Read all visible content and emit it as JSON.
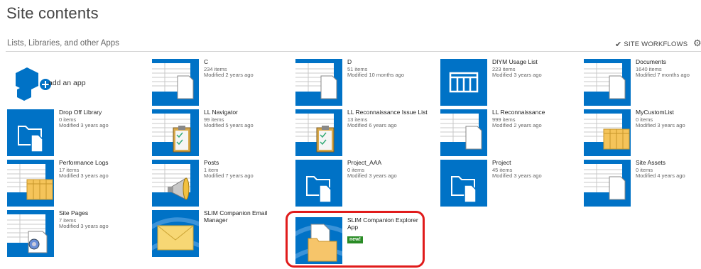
{
  "page": {
    "title": "Site contents",
    "subtitle": "Lists, Libraries, and other Apps",
    "workflows_label": "SITE WORKFLOWS"
  },
  "add_app": {
    "label": "add an app"
  },
  "tiles": [
    {
      "name": "C",
      "count": "234 items",
      "modified": "Modified 2 years ago",
      "icon": "list-icon"
    },
    {
      "name": "D",
      "count": "51 items",
      "modified": "Modified 10 months ago",
      "icon": "list-icon"
    },
    {
      "name": "DIYM Usage List",
      "count": "223 items",
      "modified": "Modified 3 years ago",
      "icon": "table-icon"
    },
    {
      "name": "Documents",
      "count": "1640 items",
      "modified": "Modified 7 months ago",
      "icon": "list-icon"
    },
    {
      "name": "Drop Off Library",
      "count": "0 items",
      "modified": "Modified 3 years ago",
      "icon": "folder-icon"
    },
    {
      "name": "LL Navigator",
      "count": "99 items",
      "modified": "Modified 5 years ago",
      "icon": "clipboard-icon"
    },
    {
      "name": "LL Reconnaissance Issue List",
      "count": "13 items",
      "modified": "Modified 6 years ago",
      "icon": "clipboard-icon"
    },
    {
      "name": "LL Reconnaissance",
      "count": "999 items",
      "modified": "Modified 2 years ago",
      "icon": "list-icon"
    },
    {
      "name": "MyCustomList",
      "count": "0 items",
      "modified": "Modified 3 years ago",
      "icon": "custom-list-icon"
    },
    {
      "name": "Performance Logs",
      "count": "17 items",
      "modified": "Modified 3 years ago",
      "icon": "custom-list-icon"
    },
    {
      "name": "Posts",
      "count": "1 item",
      "modified": "Modified 7 years ago",
      "icon": "megaphone-icon"
    },
    {
      "name": "Project_AAA",
      "count": "0 items",
      "modified": "Modified 3 years ago",
      "icon": "folder-icon"
    },
    {
      "name": "Project",
      "count": "45 items",
      "modified": "Modified 3 years ago",
      "icon": "folder-icon"
    },
    {
      "name": "Site Assets",
      "count": "0 items",
      "modified": "Modified 4 years ago",
      "icon": "list-icon"
    },
    {
      "name": "Site Pages",
      "count": "7 items",
      "modified": "Modified 3 years ago",
      "icon": "site-pages-icon"
    },
    {
      "name": "SLIM Companion Email Manager",
      "count": "",
      "modified": "",
      "icon": "envelope-icon"
    },
    {
      "name": "SLIM Companion Explorer App",
      "count": "",
      "modified": "",
      "icon": "explorer-folder-icon",
      "badge": "new!"
    }
  ],
  "colors": {
    "tile_blue": "#0072c6",
    "highlight": "#e01b1b",
    "badge_green": "#2a8c26"
  }
}
